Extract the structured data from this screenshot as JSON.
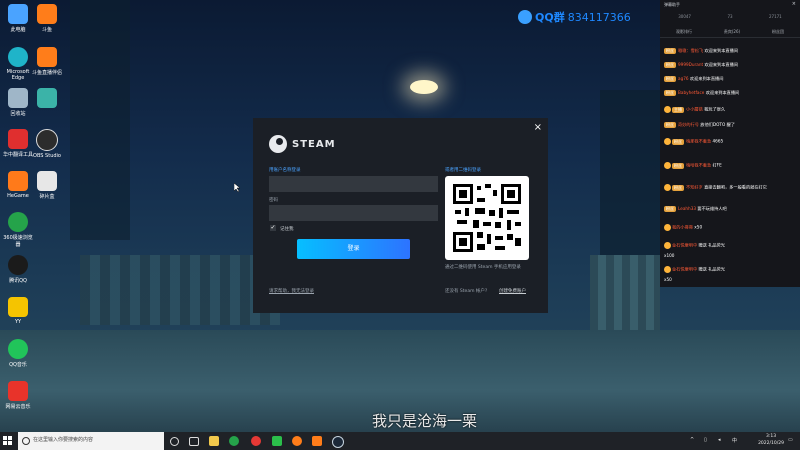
{
  "desktop": {
    "icons": [
      {
        "label": "此电脑",
        "icon": "computer-icon",
        "color": "#4aa3ff"
      },
      {
        "label": "Microsoft Edge",
        "icon": "edge-icon",
        "color": "#1fb4c9"
      },
      {
        "label": "回收站",
        "icon": "recycle-bin-icon",
        "color": "#9fb6c8"
      },
      {
        "label": "华中翻译工具",
        "icon": "translate-icon",
        "color": "#e02f2f"
      },
      {
        "label": "HeGame",
        "icon": "hegame-icon",
        "color": "#ff7a1a"
      },
      {
        "label": "360极速浏览器",
        "icon": "browser-360-icon",
        "color": "#25a34a"
      },
      {
        "label": "腾讯QQ",
        "icon": "qq-icon",
        "color": "#1b1b1b"
      },
      {
        "label": "YY",
        "icon": "yy-icon",
        "color": "#f5c400"
      },
      {
        "label": "QQ音乐",
        "icon": "qq-music-icon",
        "color": "#21c45a"
      },
      {
        "label": "网易云音乐",
        "icon": "netease-music-icon",
        "color": "#e8332a"
      },
      {
        "label": "斗鱼",
        "icon": "douyu-icon",
        "color": "#ff7d1a"
      },
      {
        "label": "斗鱼直播伴侣",
        "icon": "douyu-companion-icon",
        "color": "#ff7d1a"
      },
      {
        "label": "",
        "icon": "app-icon",
        "color": "#3bb3a8"
      },
      {
        "label": "OBS Studio",
        "icon": "obs-icon",
        "color": "#2c2c2c"
      },
      {
        "label": "碎片盒",
        "icon": "box-icon",
        "color": "#e7e7e7"
      }
    ]
  },
  "qq_watermark": {
    "label": "QQ群",
    "number": "834117366"
  },
  "steam": {
    "brand": "STEAM",
    "account_label": "用账户名称登录",
    "password_label": "密码",
    "remember_label": "记住我",
    "login_button": "登录",
    "help_link": "请求帮助，我无法登录",
    "qr_label": "或者用二维码登录",
    "qr_hint": "通过二维码使用 Steam 手机应用登录",
    "no_account": "还没有 Steam 帐户?",
    "create_account": "创建免费账户",
    "close": "×"
  },
  "subtitle": "我只是沧海一栗",
  "chat": {
    "title": "弹幕助手",
    "close": "×",
    "stats": [
      "30047",
      "73",
      "27171"
    ],
    "tabs": [
      "观影排行",
      "贵宾(26)",
      "粉丝团"
    ],
    "messages": [
      {
        "badge": "粉丝",
        "name": "嗷嗷：雪松飞",
        "text": "欢迎来到本直播间"
      },
      {
        "badge": "粉丝",
        "name": "9999Durant",
        "text": "欢迎来到本直播间"
      },
      {
        "badge": "粉丝",
        "name": "ag76",
        "text": "欢迎来到本直播间"
      },
      {
        "badge": "粉丝",
        "name": "Babyhetface",
        "text": "欢迎来到本直播间"
      },
      {
        "badge": "主播",
        "name": "小小蘑菇",
        "text": "我玩了很久"
      },
      {
        "badge": "粉丝",
        "name": "奇妙的行号",
        "text": "放他们DOTO 醒了"
      },
      {
        "badge": "粉丝",
        "name": "嗨那我不着急",
        "text": "4665"
      },
      {
        "badge": "粉丝",
        "name": "嗨哈我不着急",
        "text": "打FE"
      },
      {
        "badge": "粉丝",
        "name": "不知好歹",
        "text": "直接去翻吧，多一般看的就在打它"
      },
      {
        "badge": "粉丝",
        "name": "Leahh33",
        "text": "要不玩维持人吧"
      },
      {
        "badge": "",
        "name": "我的小哥哥",
        "text": "x50"
      },
      {
        "badge": "",
        "name": "金石悦摩明中",
        "text": "赠送 礼品荧光"
      },
      {
        "badge": "",
        "name": "金石悦摩明中",
        "text": "x100"
      },
      {
        "badge": "",
        "name": "金石悦摩明中",
        "text": "赠送 礼品荧光"
      },
      {
        "badge": "",
        "name": "",
        "text": "x50"
      }
    ]
  },
  "taskbar": {
    "search_placeholder": "在这里输入你要搜索的内容",
    "time": "3:13",
    "date": "2022/10/29",
    "input_method": "中"
  }
}
